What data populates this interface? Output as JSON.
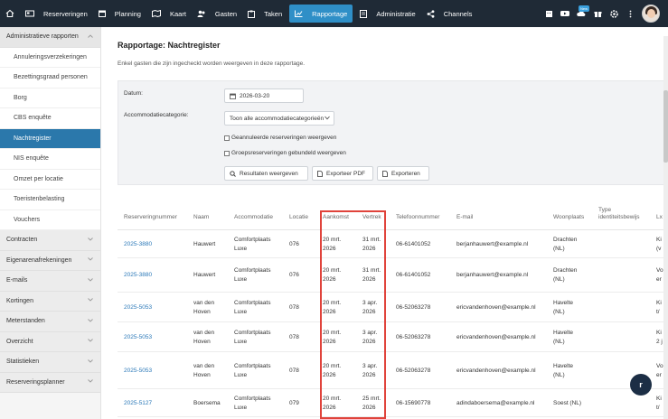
{
  "nav": {
    "items": [
      {
        "name": "nav-reserveringen",
        "label": "Reserveringen",
        "icon": "bed-icon"
      },
      {
        "name": "nav-planning",
        "label": "Planning",
        "icon": "calendar-icon"
      },
      {
        "name": "nav-kaart",
        "label": "Kaart",
        "icon": "map-icon"
      },
      {
        "name": "nav-gasten",
        "label": "Gasten",
        "icon": "users-icon"
      },
      {
        "name": "nav-taken",
        "label": "Taken",
        "icon": "clipboard-icon"
      },
      {
        "name": "nav-rapportage",
        "label": "Rapportage",
        "icon": "chart-icon",
        "active": true
      },
      {
        "name": "nav-administratie",
        "label": "Administratie",
        "icon": "ledger-icon"
      },
      {
        "name": "nav-channels",
        "label": "Channels",
        "icon": "share-icon"
      }
    ],
    "badge": "New"
  },
  "sidebar": {
    "groups": [
      {
        "label": "Administratieve rapporten",
        "open": true,
        "items": [
          "Annuleringsverzekeringen",
          "Bezettingsgraad personen",
          "Borg",
          "CBS enquête",
          "Nachtregister",
          "NIS enquête",
          "Omzet per locatie",
          "Toeristenbelasting",
          "Vouchers"
        ],
        "active_index": 4
      },
      {
        "label": "Contracten"
      },
      {
        "label": "Eigenarenafrekeningen"
      },
      {
        "label": "E-mails"
      },
      {
        "label": "Kortingen"
      },
      {
        "label": "Meterstanden"
      },
      {
        "label": "Overzicht"
      },
      {
        "label": "Statistieken"
      },
      {
        "label": "Reserveringsplanner"
      }
    ]
  },
  "page": {
    "title": "Rapportage: Nachtregister",
    "description": "Enkel gasten die zijn ingecheckt worden weergeven in deze rapportage."
  },
  "filters": {
    "date_label": "Datum:",
    "date_value": "2026-03-20",
    "category_label": "Accommodatiecategorie:",
    "category_value": "Toon alle accommodatiecategorieën",
    "check_cancelled": "Geannuleerde reserveringen weergeven",
    "check_group": "Groepsreserveringen gebundeld weergeven",
    "btn_results": "Resultaten weergeven",
    "btn_pdf": "Exporteer PDF",
    "btn_export": "Exporteren"
  },
  "table": {
    "headers": {
      "reservering": "Reserveringnummer",
      "naam": "Naam",
      "accommodatie": "Accommodatie",
      "locatie": "Locatie",
      "aankomst": "Aankomst",
      "vertrek": "Vertrek",
      "telefoon": "Telefoonnummer",
      "email": "E-mail",
      "woonplaats": "Woonplaats",
      "type_id_1": "Type",
      "type_id_2": "identiteitsbewijs",
      "extra": "Lx"
    },
    "rows": [
      {
        "res": "2025-3880",
        "naam1": "Hauwert",
        "naam2": "",
        "acc1": "Comfortplaats",
        "acc2": "Luxe",
        "loc": "076",
        "aank1": "20 mrt.",
        "aank2": "2026",
        "vert1": "31 mrt.",
        "vert2": "2026",
        "tel": "06-61401052",
        "email": "berjanhauwert@example.nl",
        "woon1": "Drachten",
        "woon2": "(NL)",
        "extra1": "Ki",
        "extra2": "(v"
      },
      {
        "res": "2025-3880",
        "naam1": "Hauwert",
        "naam2": "",
        "acc1": "Comfortplaats",
        "acc2": "Luxe",
        "loc": "076",
        "aank1": "20 mrt.",
        "aank2": "2026",
        "vert1": "31 mrt.",
        "vert2": "2026",
        "tel": "06-61401052",
        "email": "berjanhauwert@example.nl",
        "woon1": "Drachten",
        "woon2": "(NL)",
        "extra1": "Vo",
        "extra2": "er"
      },
      {
        "res": "2025-5053",
        "naam1": "van den",
        "naam2": "Hoven",
        "acc1": "Comfortplaats",
        "acc2": "Luxe",
        "loc": "078",
        "aank1": "20 mrt.",
        "aank2": "2026",
        "vert1": "3 apr.",
        "vert2": "2026",
        "tel": "06-52063278",
        "email": "ericvandenhoven@example.nl",
        "woon1": "Havelte",
        "woon2": "(NL)",
        "extra1": "Ki",
        "extra2": "t/"
      },
      {
        "res": "2025-5053",
        "naam1": "van den",
        "naam2": "Hoven",
        "acc1": "Comfortplaats",
        "acc2": "Luxe",
        "loc": "078",
        "aank1": "20 mrt.",
        "aank2": "2026",
        "vert1": "3 apr.",
        "vert2": "2026",
        "tel": "06-52063278",
        "email": "ericvandenhoven@example.nl",
        "woon1": "Havelte",
        "woon2": "(NL)",
        "extra1": "Ki",
        "extra2": "2 j"
      },
      {
        "res": "2025-5053",
        "naam1": "van den",
        "naam2": "Hoven",
        "acc1": "Comfortplaats",
        "acc2": "Luxe",
        "loc": "078",
        "aank1": "20 mrt.",
        "aank2": "2026",
        "vert1": "3 apr.",
        "vert2": "2026",
        "tel": "06-52063278",
        "email": "ericvandenhoven@example.nl",
        "woon1": "Havelte",
        "woon2": "(NL)",
        "extra1": "Vo",
        "extra2": "er"
      },
      {
        "res": "2025-5127",
        "naam1": "Boersema",
        "naam2": "",
        "acc1": "Comfortplaats",
        "acc2": "Luxe",
        "loc": "079",
        "aank1": "20 mrt.",
        "aank2": "2026",
        "vert1": "25 mrt.",
        "vert2": "2026",
        "tel": "06-15690778",
        "email": "adindaboersema@example.nl",
        "woon1": "Soest (NL)",
        "woon2": "",
        "extra1": "Ki",
        "extra2": "t/"
      }
    ]
  },
  "fab_label": "r",
  "colors": {
    "nav_bg": "#1f2a36",
    "nav_active": "#2f8fc7",
    "sidebar_active": "#2b78ab",
    "link": "#2a78b8",
    "highlight": "#e0433b"
  }
}
